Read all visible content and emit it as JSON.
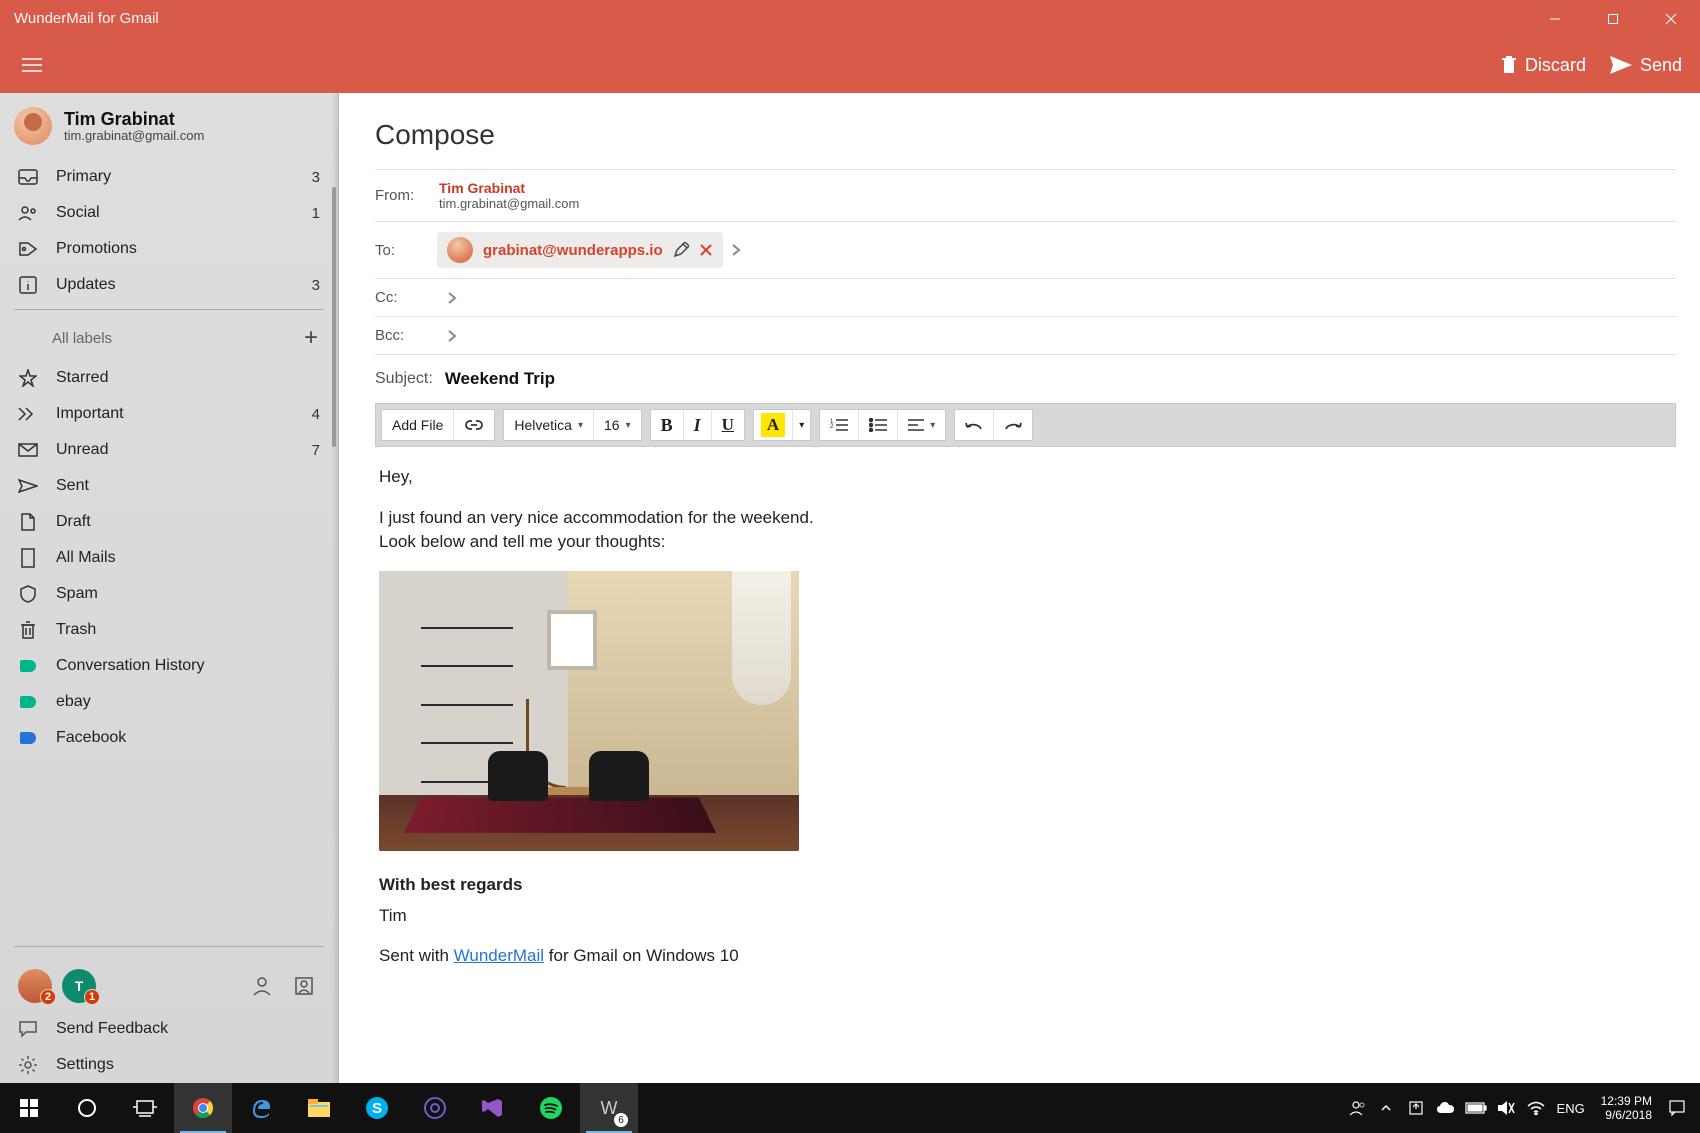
{
  "app": {
    "title": "WunderMail for Gmail"
  },
  "toolbar": {
    "discard": "Discard",
    "send": "Send"
  },
  "account": {
    "name": "Tim Grabinat",
    "email": "tim.grabinat@gmail.com"
  },
  "sidebar": {
    "primary": {
      "label": "Primary",
      "count": "3"
    },
    "social": {
      "label": "Social",
      "count": "1"
    },
    "promotions": {
      "label": "Promotions",
      "count": ""
    },
    "updates": {
      "label": "Updates",
      "count": "3"
    },
    "all_labels_header": "All labels",
    "starred": {
      "label": "Starred",
      "count": ""
    },
    "important": {
      "label": "Important",
      "count": "4"
    },
    "unread": {
      "label": "Unread",
      "count": "7"
    },
    "sent": {
      "label": "Sent",
      "count": ""
    },
    "draft": {
      "label": "Draft",
      "count": ""
    },
    "allmails": {
      "label": "All Mails",
      "count": ""
    },
    "spam": {
      "label": "Spam",
      "count": ""
    },
    "trash": {
      "label": "Trash",
      "count": ""
    },
    "convhist": {
      "label": "Conversation History",
      "count": ""
    },
    "ebay": {
      "label": "ebay",
      "count": ""
    },
    "facebook": {
      "label": "Facebook",
      "count": ""
    },
    "send_feedback": "Send Feedback",
    "settings": "Settings",
    "footer_accounts": [
      {
        "badge": "2"
      },
      {
        "initial": "T",
        "badge": "1"
      }
    ]
  },
  "compose": {
    "heading": "Compose",
    "labels": {
      "from": "From:",
      "to": "To:",
      "cc": "Cc:",
      "bcc": "Bcc:",
      "subject": "Subject:"
    },
    "from": {
      "name": "Tim Grabinat",
      "email": "tim.grabinat@gmail.com"
    },
    "to": [
      {
        "email": "grabinat@wunderapps.io"
      }
    ],
    "subject": "Weekend Trip",
    "editor_toolbar": {
      "add_file": "Add File",
      "font_family": "Helvetica",
      "font_size": "16",
      "bold": "B",
      "italic": "I",
      "underline": "U",
      "color": "A"
    },
    "body": {
      "greeting": "Hey,",
      "line1": "I just found an very nice accommodation for the weekend.",
      "line2": "Look below and tell me your thoughts:",
      "regards_bold": "With best regards",
      "signature_name": "Tim",
      "sent_prefix": "Sent with ",
      "sent_link": "WunderMail",
      "sent_suffix": " for Gmail on Windows 10"
    }
  },
  "taskbar": {
    "lang": "ENG",
    "time": "12:39 PM",
    "date": "9/6/2018",
    "w_badge": "6"
  }
}
